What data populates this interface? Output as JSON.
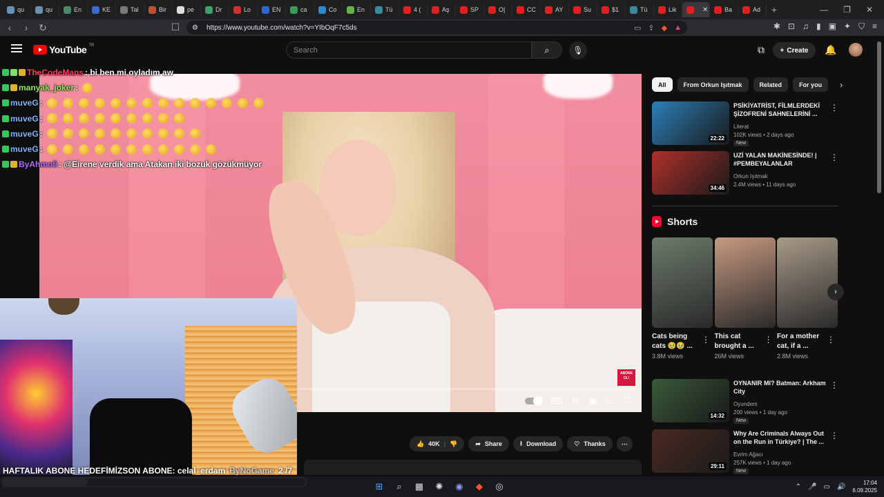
{
  "browser": {
    "tabs": [
      "qu",
      "qu",
      "En",
      "KE",
      "Tal",
      "Bir",
      "pe",
      "Dr",
      "Lo",
      "EN",
      "ca",
      "Co",
      "En",
      "Tü",
      "4 (",
      "Aş",
      "SP",
      "O|",
      "CC",
      "AY",
      "Su",
      "$1",
      "Tü",
      "Lik",
      "",
      "Ba",
      "Ad"
    ],
    "url": "https://www.youtube.com/watch?v=YIbOqF7c5ds"
  },
  "youtube": {
    "logo_text": "YouTube",
    "country": "TR",
    "search_placeholder": "Search",
    "create_label": "Create"
  },
  "chat": [
    {
      "user": "TheCodeMans",
      "color": "#ff3a5c",
      "badges": [
        "b-green",
        "b-lime",
        "b-gold"
      ],
      "message": ": bi ben mi oyladım aw",
      "emotes": 0
    },
    {
      "user": "manyak_joker",
      "color": "#9be85a",
      "badges": [
        "b-green",
        "b-gold"
      ],
      "message": ":",
      "emotes": 1
    },
    {
      "user": "muveG",
      "color": "#7fb5ff",
      "badges": [
        "b-green"
      ],
      "message": ":",
      "emotes": 14
    },
    {
      "user": "muveG",
      "color": "#7fb5ff",
      "badges": [
        "b-green"
      ],
      "message": ":",
      "emotes": 9
    },
    {
      "user": "muveG",
      "color": "#7fb5ff",
      "badges": [
        "b-green"
      ],
      "message": ":",
      "emotes": 10
    },
    {
      "user": "muveG",
      "color": "#7fb5ff",
      "badges": [
        "b-green"
      ],
      "message": ":",
      "emotes": 11
    },
    {
      "user": "ByAhmoli",
      "color": "#b56cff",
      "badges": [
        "b-green",
        "b-gold"
      ],
      "message": ": @Eirene verdik ama Atakan iki bozuk gözükmüyor",
      "emotes": 0
    }
  ],
  "overlay": {
    "ticker_text": "HAFTALIK ABONE HEDEFİMİZSON ABONE: celal_erdam",
    "ticker_brand": "ByNoGame",
    "ticker_count": "2 /7",
    "abone_badge": "ABONE OL!",
    "progress_fraction": 0.28
  },
  "actions": {
    "likes": "40K",
    "share": "Share",
    "download": "Download",
    "thanks": "Thanks"
  },
  "chips": [
    "All",
    "From Orkun Işıtmak",
    "Related",
    "For you"
  ],
  "recommended_top": [
    {
      "title": "PSİKİYATRİST, FİLMLERDEKİ ŞİZOFRENİ SAHNELERİNİ ...",
      "channel": "Literat",
      "meta": "102K views • 2 days ago",
      "badge": "New",
      "duration": "22:22",
      "thumb": "#2b7fb8"
    },
    {
      "title": "UZİ YALAN MAKİNESİNDE! | #PEMBEYALANLAR",
      "channel": "Orkun Işıtmak",
      "meta": "2.4M views • 11 days ago",
      "badge": "",
      "duration": "34:46",
      "thumb": "#b0302a"
    }
  ],
  "shorts": {
    "title": "Shorts",
    "items": [
      {
        "title": "Cats being cats 🥹🥹 ...",
        "views": "3.8M views",
        "thumb": "#6c7a6a"
      },
      {
        "title": "This cat brought a ...",
        "views": "26M views",
        "thumb": "#c79a80"
      },
      {
        "title": "For a mother cat, if a ...",
        "views": "2.8M views",
        "thumb": "#a89a88"
      }
    ]
  },
  "recommended_bottom": [
    {
      "title": "OYNANIR MI? Batman: Arkham City",
      "channel": "Oyundem",
      "meta": "200 views • 1 day ago",
      "badge": "New",
      "duration": "14:32",
      "thumb": "#3a5a3a"
    },
    {
      "title": "Why Are Criminals Always Out on the Run in Türkiye? | The ...",
      "channel": "Evrim Ağacı",
      "meta": "257K views • 1 day ago",
      "badge": "New",
      "duration": "29:11",
      "thumb": "#4a2a22"
    }
  ],
  "taskbar": {
    "time": "17:04",
    "date": "6.09.2025"
  }
}
